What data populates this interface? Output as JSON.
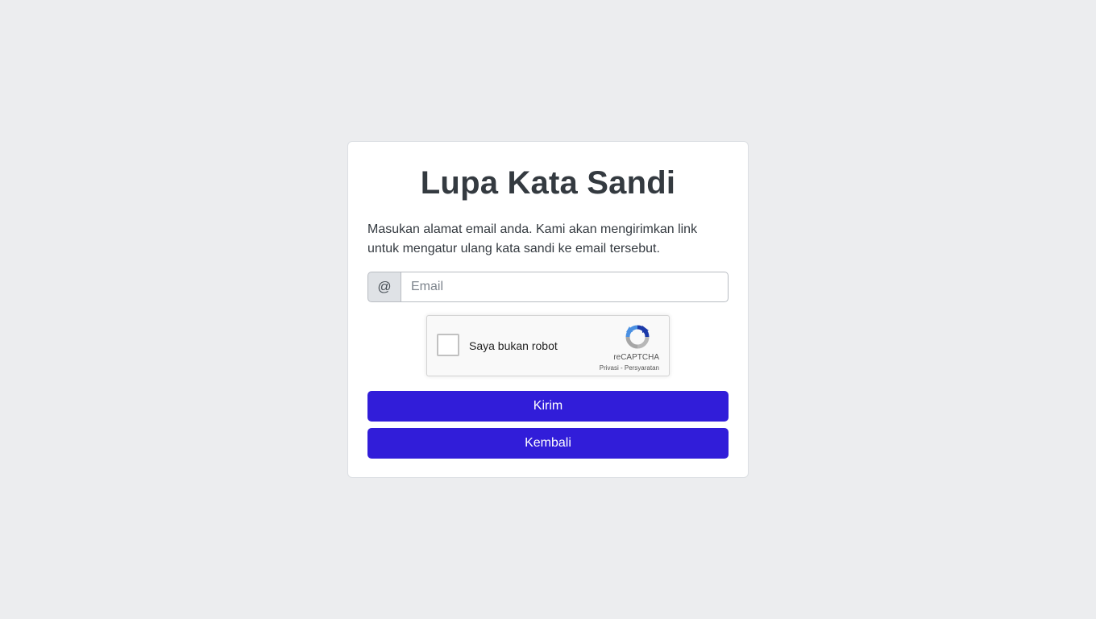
{
  "page": {
    "title": "Lupa Kata Sandi",
    "description": "Masukan alamat email anda. Kami akan mengirimkan link untuk mengatur ulang kata sandi ke email tersebut."
  },
  "email": {
    "prefix": "@",
    "value": "",
    "placeholder": "Email"
  },
  "captcha": {
    "label": "Saya bukan robot",
    "brand": "reCAPTCHA",
    "privacy": "Privasi",
    "separator": " - ",
    "terms": "Persyaratan"
  },
  "buttons": {
    "submit": "Kirim",
    "back": "Kembali"
  },
  "colors": {
    "background": "#ecedef",
    "primary": "#311dd9",
    "text": "#343a40"
  }
}
